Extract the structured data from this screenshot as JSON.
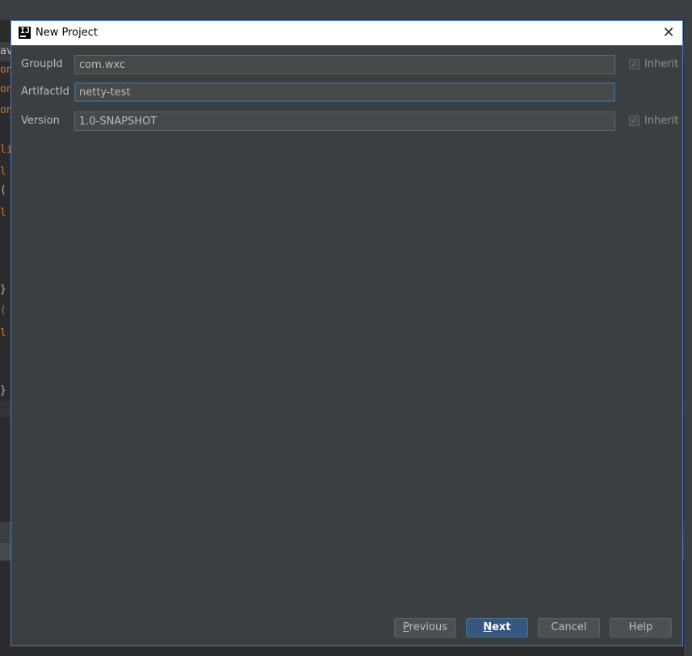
{
  "window": {
    "title": "New Project",
    "close_glyph": "✕"
  },
  "background_code": [
    {
      "text": "av",
      "color": "#bbbbbb"
    },
    {
      "text": "on",
      "color": "#cc7832"
    },
    {
      "text": "on",
      "color": "#cc7832"
    },
    {
      "text": "on",
      "color": "#cc7832"
    },
    {
      "text": "li",
      "color": "#cc7832"
    },
    {
      "text": "l",
      "color": "#cc7832"
    },
    {
      "text": "(",
      "color": "#a9b7c6"
    },
    {
      "text": "l",
      "color": "#cc7832"
    },
    {
      "text": "}",
      "color": "#a9b7c6"
    },
    {
      "text": "(",
      "color": "#6a8759"
    },
    {
      "text": "l",
      "color": "#cc7832"
    },
    {
      "text": "}",
      "color": "#a9b7c6"
    }
  ],
  "form": {
    "group_id": {
      "label": "GroupId",
      "value": "com.wxc",
      "inherit_label": "Inherit",
      "inherit_checked": true
    },
    "artifact_id": {
      "label": "ArtifactId",
      "value": "netty-test"
    },
    "version": {
      "label": "Version",
      "value": "1.0-SNAPSHOT",
      "inherit_label": "Inherit",
      "inherit_checked": true
    }
  },
  "buttons": {
    "previous": {
      "mnemonic": "P",
      "rest": "revious"
    },
    "next": {
      "mnemonic": "N",
      "rest": "ext"
    },
    "cancel": "Cancel",
    "help": "Help"
  },
  "icons": {
    "app": "intellij-idea-icon",
    "close": "close-icon",
    "checkmark": "✓"
  },
  "colors": {
    "accent": "#365880",
    "focus_border": "#3d6185",
    "dialog_bg": "#3c3f41"
  }
}
